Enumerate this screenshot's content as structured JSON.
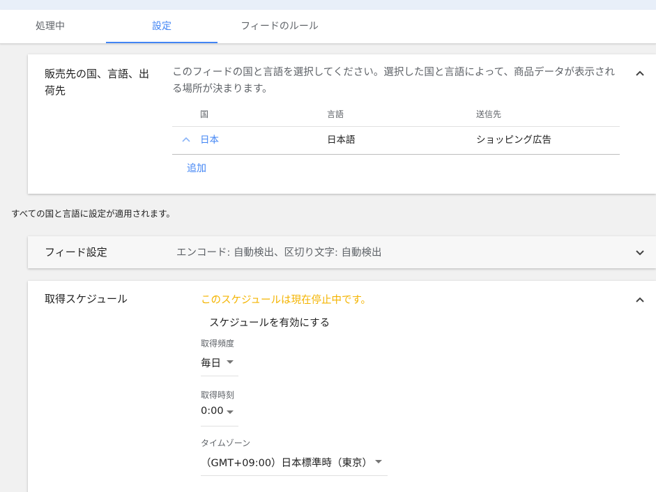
{
  "tabs": [
    {
      "label": "処理中"
    },
    {
      "label": "設定"
    },
    {
      "label": "フィードのルール"
    }
  ],
  "targets_card": {
    "title": "販売先の国、言語、出荷先",
    "description": "このフィードの国と言語を選択してください。選択した国と言語によって、商品データが表示される場所が決まります。",
    "columns": {
      "country": "国",
      "language": "言語",
      "destination": "送信先"
    },
    "row": {
      "country": "日本",
      "language": "日本語",
      "destination": "ショッピング広告"
    },
    "add_label": "追加"
  },
  "note": "すべての国と言語に設定が適用されます。",
  "feed_settings": {
    "title": "フィード設定",
    "summary": "エンコード: 自動検出、区切り文字: 自動検出"
  },
  "schedule": {
    "title": "取得スケジュール",
    "paused_message": "このスケジュールは現在停止中です。",
    "enable_label": "スケジュールを有効にする",
    "frequency": {
      "label": "取得頻度",
      "value": "毎日"
    },
    "time": {
      "label": "取得時刻",
      "value": "0:00"
    },
    "timezone": {
      "label": "タイムゾーン",
      "value": "（GMT+09:00）日本標準時（東京）"
    }
  },
  "colors": {
    "accent": "#4285f4",
    "warning": "#f4b400"
  }
}
